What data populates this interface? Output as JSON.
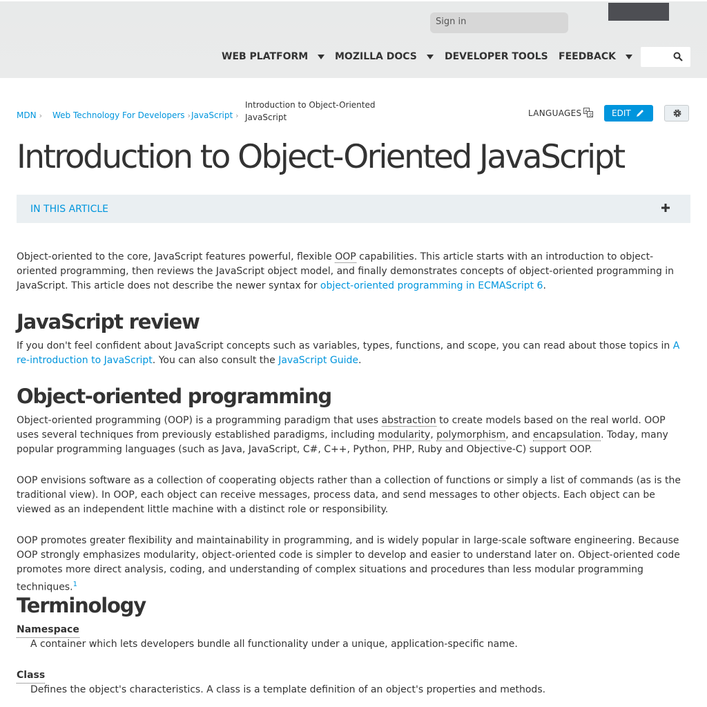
{
  "header": {
    "signin_placeholder": "Sign in",
    "nav": [
      {
        "label": "WEB PLATFORM"
      },
      {
        "label": "MOZILLA DOCS"
      },
      {
        "label": "DEVELOPER TOOLS"
      },
      {
        "label": "FEEDBACK"
      }
    ]
  },
  "breadcrumb": {
    "items": [
      "MDN",
      "Web Technology For Developers",
      "JavaScript"
    ],
    "current": "Introduction to Object-Oriented JavaScript"
  },
  "actions": {
    "languages": "LANGUAGES",
    "edit": "EDIT"
  },
  "page": {
    "title": "Introduction to Object-Oriented JavaScript",
    "toc_label": "IN THIS ARTICLE"
  },
  "article": {
    "intro": {
      "a": "Object-oriented to the core, JavaScript features powerful, flexible ",
      "abbr": "OOP",
      "b": " capabilities. This article starts with an introduction to object-oriented programming, then reviews the JavaScript object model, and finally demonstrates concepts of object-oriented programming in JavaScript. This article does not describe the newer syntax for ",
      "link": "object-oriented programming in ECMAScript 6",
      "c": "."
    },
    "h_review": "JavaScript review",
    "review": {
      "a": "If you don't feel confident about JavaScript concepts such as variables, types, functions, and scope, you can read about those topics in ",
      "link1": "A re-introduction to JavaScript",
      "b": ". You can also consult the ",
      "link2": "JavaScript Guide",
      "c": "."
    },
    "h_oop": "Object-oriented programming",
    "oop1": {
      "a": "Object-oriented programming (OOP) is a programming paradigm that uses ",
      "t1": "abstraction",
      "b": " to create models based on the real world. OOP uses several techniques from previously established paradigms, including ",
      "t2": "modularity",
      "c": ", ",
      "t3": "polymorphism",
      "d": ", and ",
      "t4": "encapsulation",
      "e": ". Today, many popular programming languages (such as Java, JavaScript, C#, C++, Python, PHP, Ruby and Objective-C) support OOP."
    },
    "oop2": "OOP envisions software as a collection of cooperating objects rather than a collection of functions or simply a list of commands (as is the traditional view). In OOP, each object can receive messages, process data, and send messages to other objects. Each object can be viewed as an independent little machine with a distinct role or responsibility.",
    "oop3": "OOP promotes greater flexibility and maintainability in programming, and is widely popular in large-scale software engineering. Because OOP strongly emphasizes modularity, object-oriented code is simpler to develop and easier to understand later on. Object-oriented code promotes more direct analysis, coding, and understanding of complex situations and procedures than less modular programming techniques.",
    "oop3_sup": "1",
    "h_term": "Terminology",
    "terms": [
      {
        "term": "Namespace",
        "def": "A container which lets developers bundle all functionality under a unique, application-specific name."
      },
      {
        "term": "Class",
        "def": "Defines the object's characteristics. A class is a template definition of an object's properties and methods."
      }
    ]
  }
}
